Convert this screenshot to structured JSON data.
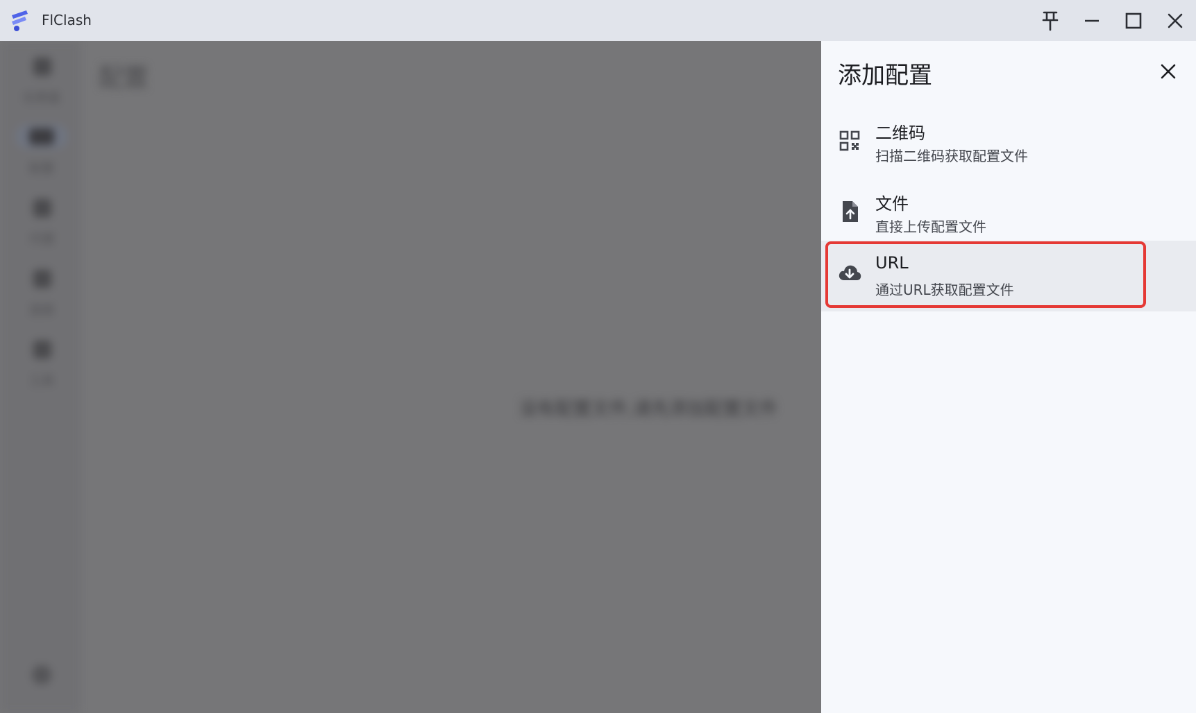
{
  "window": {
    "title": "FlClash"
  },
  "backdrop": {
    "title": "配置",
    "empty_hint": "没有配置文件,请先添加配置文件",
    "rail": [
      {
        "label": "仪表盘"
      },
      {
        "label": "配置"
      },
      {
        "label": "代理"
      },
      {
        "label": "连接"
      },
      {
        "label": "工具"
      }
    ]
  },
  "sheet": {
    "title": "添加配置",
    "options": [
      {
        "title": "二维码",
        "subtitle": "扫描二维码获取配置文件",
        "icon": "qr-code-icon"
      },
      {
        "title": "文件",
        "subtitle": "直接上传配置文件",
        "icon": "file-upload-icon"
      },
      {
        "title": "URL",
        "subtitle": "通过URL获取配置文件",
        "icon": "cloud-download-icon"
      }
    ]
  },
  "colors": {
    "highlight": "#e53935",
    "logo": "#5b6ef5"
  }
}
